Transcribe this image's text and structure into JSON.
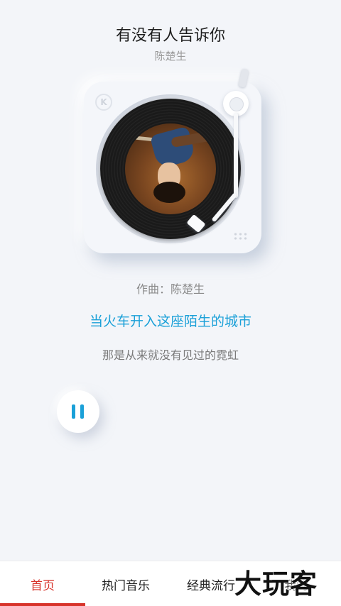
{
  "song": {
    "title": "有没有人告诉你",
    "artist": "陈楚生",
    "composer": "作曲：陈楚生"
  },
  "lyrics": {
    "current": "当火车开入这座陌生的城市",
    "next": "那是从来就没有见过的霓虹"
  },
  "turntable": {
    "logo_letter": "K"
  },
  "player": {
    "state": "playing",
    "control_icon": "pause-icon"
  },
  "tabs": [
    {
      "label": "首页",
      "active": true
    },
    {
      "label": "热门音乐",
      "active": false
    },
    {
      "label": "经典流行",
      "active": false
    },
    {
      "label": "我的",
      "active": false
    }
  ],
  "watermark": "大玩客",
  "colors": {
    "accent": "#1aa0d8",
    "active_tab": "#d7332a",
    "background": "#f3f5f9"
  }
}
